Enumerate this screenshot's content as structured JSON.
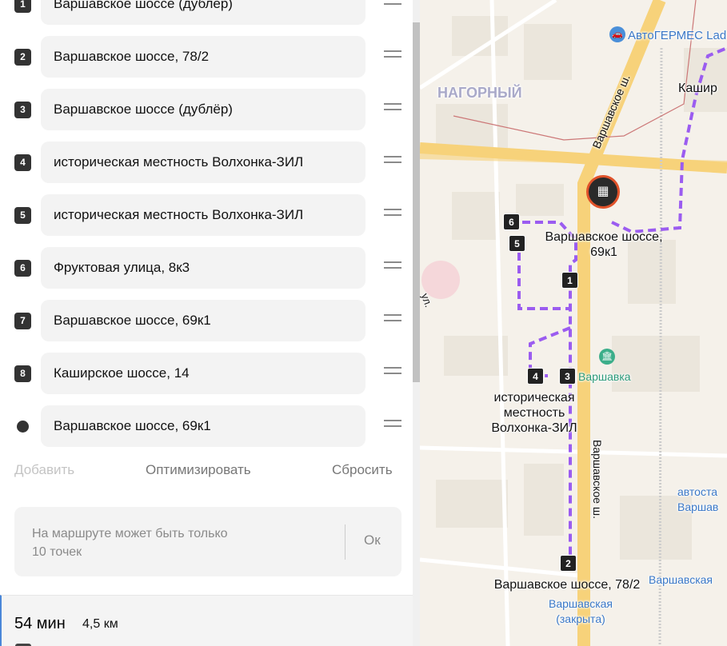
{
  "waypoints": [
    {
      "badge": "1",
      "label": "Варшавское шоссе (дублёр)"
    },
    {
      "badge": "2",
      "label": "Варшавское шоссе, 78/2"
    },
    {
      "badge": "3",
      "label": "Варшавское шоссе (дублёр)"
    },
    {
      "badge": "4",
      "label": "историческая местность Волхонка-ЗИЛ"
    },
    {
      "badge": "5",
      "label": "историческая местность Волхонка-ЗИЛ"
    },
    {
      "badge": "6",
      "label": "Фруктовая улица, 8к3"
    },
    {
      "badge": "7",
      "label": "Варшавское шоссе, 69к1"
    },
    {
      "badge": "8",
      "label": "Каширское шоссе, 14"
    },
    {
      "badge": "",
      "label": "Варшавское шоссе, 69к1"
    }
  ],
  "actions": {
    "add": "Добавить",
    "optimize": "Оптимизировать",
    "reset": "Сбросить"
  },
  "notice": {
    "text": "На маршруте может быть только 10 точек",
    "ok": "Ок"
  },
  "summary": {
    "time": "54 мин",
    "distance": "4,5 км"
  },
  "map": {
    "labels": {
      "district": "НАГОРНЫЙ",
      "poi_autohermes": "АвтоГЕРМЕС Lad",
      "kashir": "Кашир",
      "road_varsh_top": "Варшавское ш.",
      "road_varsh_bottom": "Варшавское ш.",
      "point_69k1": "Варшавское шоссе, 69к1",
      "point_volkhonka": "историческая местность Волхонка-ЗИЛ",
      "point_78_2": "Варшавское шоссе, 78/2",
      "metro_varshavka": "Варшавка",
      "station_varshavskaya": "Варшавская",
      "station_closed": "Варшавская (закрыта)",
      "bus_station": "автоста Варшав",
      "street_ul": "ул."
    },
    "markers": [
      "1",
      "2",
      "3",
      "4",
      "5",
      "6"
    ],
    "route_color": "#9b5cf0",
    "road_color": "#f7d27a"
  }
}
